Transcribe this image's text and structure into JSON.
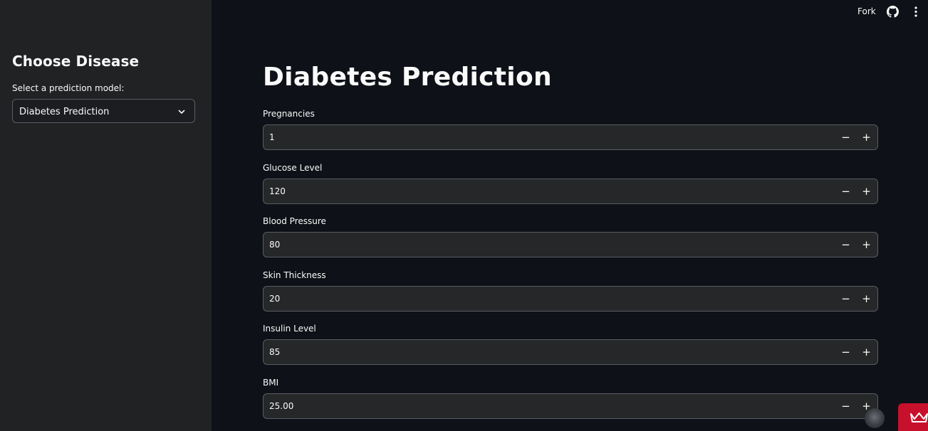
{
  "sidebar": {
    "title": "Choose Disease",
    "select_label": "Select a prediction model:",
    "select_value": "Diabetes Prediction"
  },
  "header": {
    "fork_label": "Fork",
    "github_icon": "github-icon",
    "menu_icon": "kebab-menu-icon"
  },
  "main": {
    "title": "Diabetes Prediction",
    "fields": [
      {
        "label": "Pregnancies",
        "value": "1"
      },
      {
        "label": "Glucose Level",
        "value": "120"
      },
      {
        "label": "Blood Pressure",
        "value": "80"
      },
      {
        "label": "Skin Thickness",
        "value": "20"
      },
      {
        "label": "Insulin Level",
        "value": "85"
      },
      {
        "label": "BMI",
        "value": "25.00"
      }
    ],
    "minus_symbol": "−",
    "plus_symbol": "+"
  },
  "colors": {
    "background": "#0e1117",
    "sidebar": "#202224",
    "input_bg": "#262729",
    "border": "#5a5d63",
    "badge": "#c7102b"
  }
}
